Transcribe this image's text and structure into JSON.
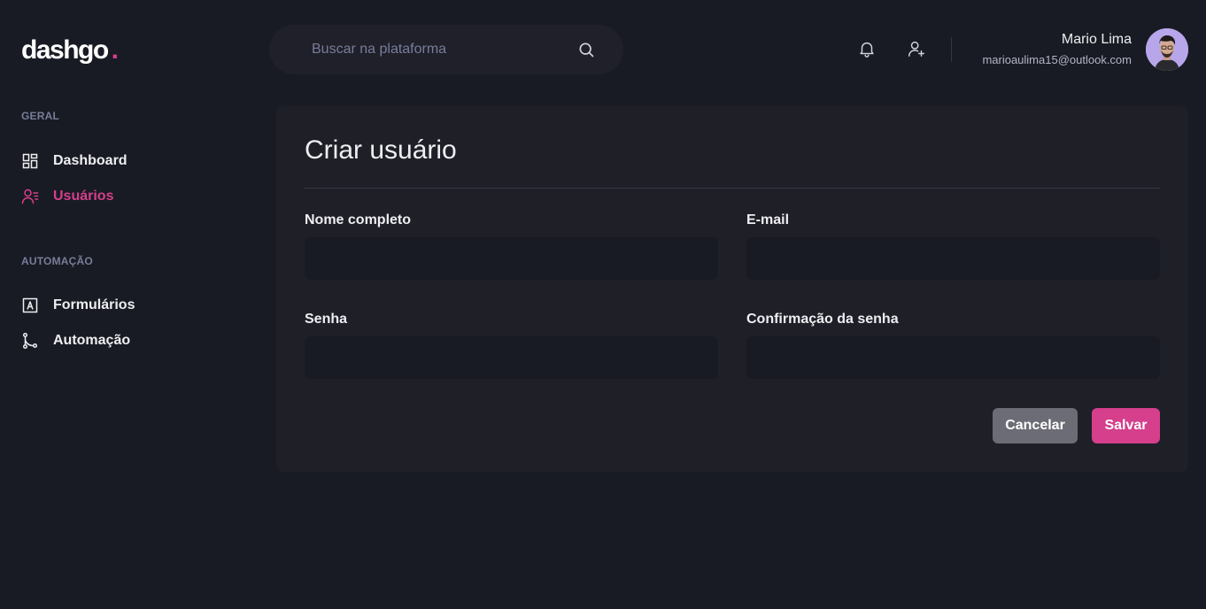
{
  "brand": {
    "name": "dashgo",
    "dot": ".",
    "accent": "#d53f8c"
  },
  "search": {
    "placeholder": "Buscar na plataforma",
    "icon": "search-icon"
  },
  "header": {
    "icons": [
      "bell-icon",
      "user-add-icon"
    ],
    "profile": {
      "name": "Mario Lima",
      "email": "marioaulima15@outlook.com"
    }
  },
  "sidebar": {
    "sections": [
      {
        "title": "GERAL",
        "items": [
          {
            "label": "Dashboard",
            "icon": "dashboard-icon",
            "active": false
          },
          {
            "label": "Usuários",
            "icon": "users-icon",
            "active": true
          }
        ]
      },
      {
        "title": "AUTOMAÇÃO",
        "items": [
          {
            "label": "Formulários",
            "icon": "form-icon",
            "active": false
          },
          {
            "label": "Automação",
            "icon": "git-merge-icon",
            "active": false
          }
        ]
      }
    ]
  },
  "form": {
    "title": "Criar usuário",
    "fields": [
      {
        "label": "Nome completo",
        "value": ""
      },
      {
        "label": "E-mail",
        "value": ""
      },
      {
        "label": "Senha",
        "value": ""
      },
      {
        "label": "Confirmação da senha",
        "value": ""
      }
    ],
    "cancel_label": "Cancelar",
    "save_label": "Salvar"
  },
  "colors": {
    "background": "#181b23",
    "card": "#1f1f28",
    "accent": "#d53f8c",
    "cancel": "#6c6c76",
    "muted": "#797d9a"
  }
}
